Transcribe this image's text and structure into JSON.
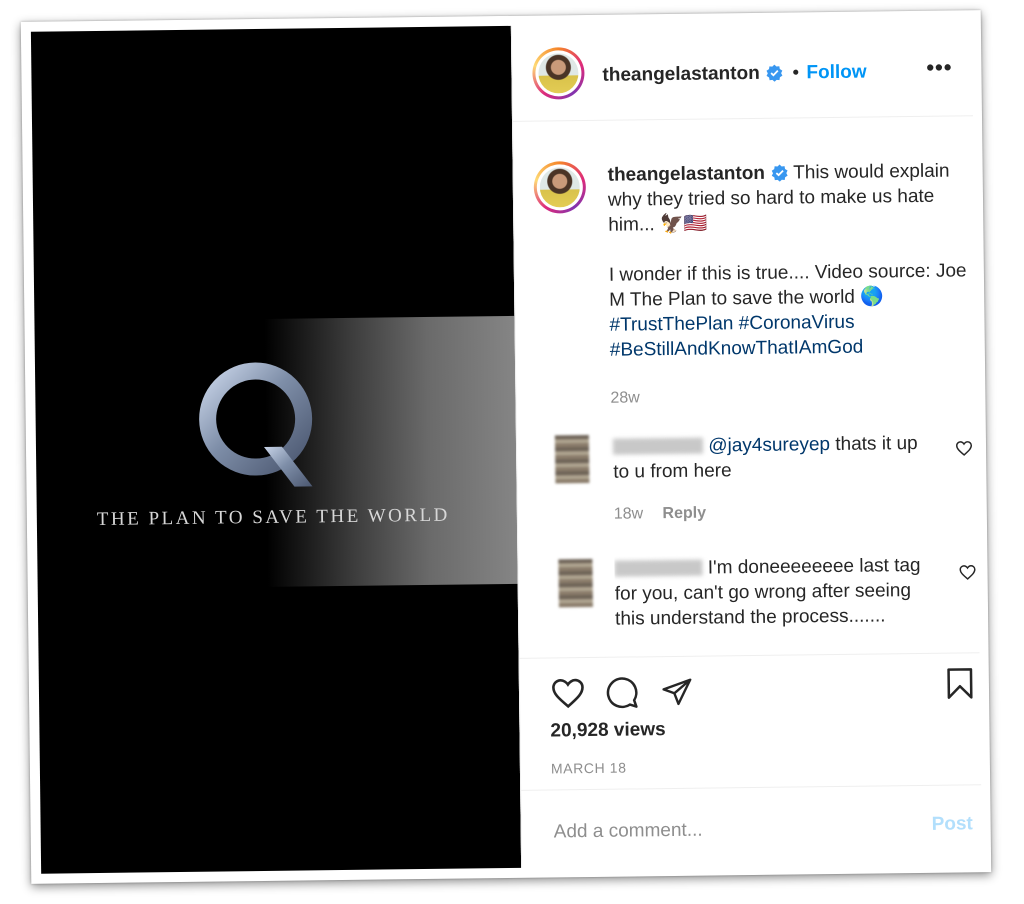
{
  "media": {
    "logo_letter": "Q",
    "tagline": "THE PLAN TO SAVE THE WORLD"
  },
  "header": {
    "username": "theangelastanton",
    "separator": "•",
    "follow_label": "Follow",
    "more_label": "•••"
  },
  "caption": {
    "username": "theangelastanton",
    "line1": "This would explain why they tried so hard to make us hate him... 🦅🇺🇸",
    "line2": "I wonder if this is true.... Video source: Joe M The Plan to save the world 🌎",
    "hashtag1": "#TrustThePlan",
    "hashtag2": "#CoronaVirus",
    "hashtag3": "#BeStillAndKnowThatIAmGod",
    "age": "28w"
  },
  "comments": [
    {
      "mention": "@jay4sureyep",
      "text": " thats it up to u from here",
      "age": "18w",
      "reply_label": "Reply"
    },
    {
      "text": "I'm doneeeeeeee last tag for you, can't go wrong after seeing this understand the process......."
    }
  ],
  "stats": {
    "views": "20,928 views",
    "date": "MARCH 18"
  },
  "add_comment": {
    "placeholder": "Add a comment...",
    "post_label": "Post"
  },
  "colors": {
    "link_blue": "#0095f6",
    "hashtag_blue": "#00376b",
    "muted": "#8e8e8e",
    "text": "#262626"
  }
}
